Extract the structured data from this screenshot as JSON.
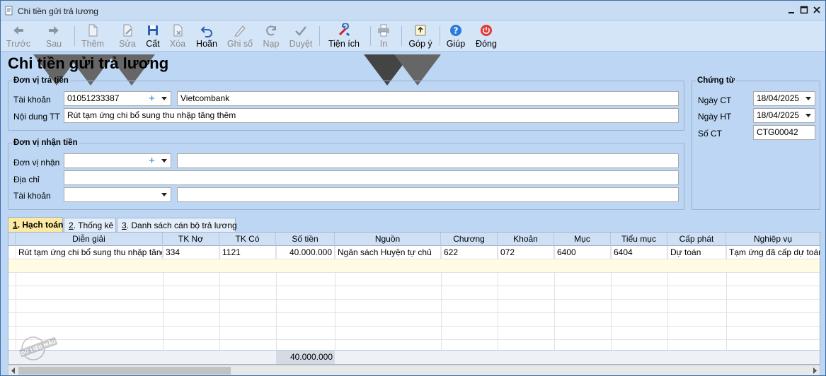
{
  "window": {
    "title": "Chi tiền gửi trả lương"
  },
  "toolbar": {
    "items": [
      {
        "label": "Trước",
        "icon": "arrow-left-icon",
        "enabled": false
      },
      {
        "label": "Sau",
        "icon": "arrow-right-icon",
        "enabled": false
      },
      {
        "label": "Thêm",
        "icon": "new-document-icon",
        "enabled": false
      },
      {
        "label": "Sửa",
        "icon": "edit-document-icon",
        "enabled": false
      },
      {
        "label": "Cất",
        "icon": "save-icon",
        "enabled": true
      },
      {
        "label": "Xóa",
        "icon": "delete-icon",
        "enabled": false
      },
      {
        "label": "Hoãn",
        "icon": "undo-icon",
        "enabled": true
      },
      {
        "label": "Ghi sổ",
        "icon": "pencil-icon",
        "enabled": false
      },
      {
        "label": "Nạp",
        "icon": "refresh-icon",
        "enabled": false
      },
      {
        "label": "Duyệt",
        "icon": "check-icon",
        "enabled": false
      },
      {
        "label": "Tiện ích",
        "icon": "tools-icon",
        "enabled": true
      },
      {
        "label": "In",
        "icon": "printer-icon",
        "enabled": false
      },
      {
        "label": "Góp ý",
        "icon": "feedback-icon",
        "enabled": true
      },
      {
        "label": "Giúp",
        "icon": "help-icon",
        "enabled": true
      },
      {
        "label": "Đóng",
        "icon": "power-icon",
        "enabled": true
      }
    ]
  },
  "page_title": "Chi tiền gửi trả lương",
  "payer": {
    "legend": "Đơn vị trả tiền",
    "account_label": "Tài khoản",
    "account_value": "01051233387",
    "bank_name": "Vietcombank",
    "content_label": "Nội dung TT",
    "content_value": "Rút tạm ứng chi bổ sung thu nhập tăng thêm"
  },
  "payee": {
    "legend": "Đơn vị nhận tiền",
    "unit_label": "Đơn vị nhận",
    "unit_value": "",
    "unit_name": "",
    "address_label": "Địa chỉ",
    "address_value": "",
    "account_label": "Tài khoản",
    "account_value": "",
    "bank_value": ""
  },
  "voucher": {
    "legend": "Chứng từ",
    "date_ct_label": "Ngày CT",
    "date_ct_value": "18/04/2025",
    "date_ht_label": "Ngày HT",
    "date_ht_value": "18/04/2025",
    "number_label": "Số CT",
    "number_value": "CTG00042"
  },
  "tabs": [
    {
      "key": "1",
      "label": ". Hạch toán",
      "active": true
    },
    {
      "key": "2",
      "label": ". Thống kê",
      "active": false
    },
    {
      "key": "3",
      "label": ". Danh sách cán bộ trả lương",
      "active": false
    }
  ],
  "grid": {
    "columns": [
      "Diễn giải",
      "TK Nợ",
      "TK Có",
      "Số tiền",
      "Nguồn",
      "Chương",
      "Khoản",
      "Mục",
      "Tiểu mục",
      "Cấp phát",
      "Nghiệp vụ"
    ],
    "rows": [
      [
        "Rút tạm ứng chi bổ sung thu nhập tăng...",
        "334",
        "1121",
        "40.000.000",
        "Ngân sách Huyện tự chủ",
        "622",
        "072",
        "6400",
        "6404",
        "Dự toán",
        "Tạm ứng đã cấp dự toán"
      ]
    ],
    "total": "40.000.000"
  },
  "stamp_text": "DỮ LIỆU MẪU"
}
